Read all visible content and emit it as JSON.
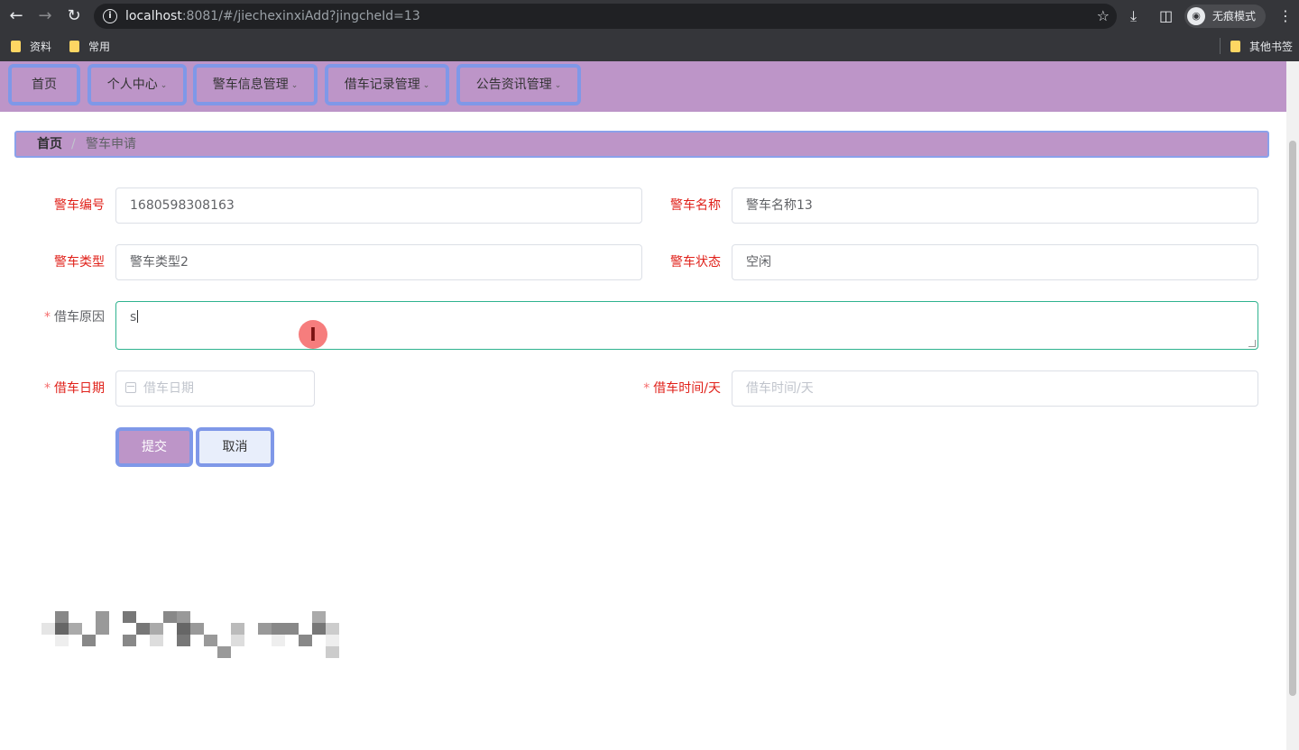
{
  "browser": {
    "url_host": "localhost",
    "url_rest": ":8081/#/jiechexinxiAdd?jingcheId=13",
    "profile_label": "无痕模式",
    "bookmarks": [
      "资料",
      "常用"
    ],
    "other_bookmarks": "其他书签"
  },
  "nav": {
    "items": [
      {
        "label": "首页",
        "has_dropdown": false
      },
      {
        "label": "个人中心",
        "has_dropdown": true
      },
      {
        "label": "警车信息管理",
        "has_dropdown": true
      },
      {
        "label": "借车记录管理",
        "has_dropdown": true
      },
      {
        "label": "公告资讯管理",
        "has_dropdown": true
      }
    ]
  },
  "breadcrumb": {
    "home": "首页",
    "separator": "/",
    "current": "警车申请"
  },
  "form": {
    "car_number": {
      "label": "警车编号",
      "value": "1680598308163"
    },
    "car_name": {
      "label": "警车名称",
      "value": "警车名称13"
    },
    "car_type": {
      "label": "警车类型",
      "value": "警车类型2"
    },
    "car_status": {
      "label": "警车状态",
      "value": "空闲"
    },
    "reason": {
      "label": "借车原因",
      "value": "s",
      "required": true
    },
    "borrow_date": {
      "label": "借车日期",
      "placeholder": "借车日期",
      "required": true
    },
    "borrow_days": {
      "label": "借车时间/天",
      "placeholder": "借车时间/天",
      "required": true
    },
    "required_mark": "*",
    "submit_label": "提交",
    "cancel_label": "取消"
  },
  "colors": {
    "theme_purple": "#bd95c8",
    "highlight_blue": "#7f98e8",
    "label_red": "#e0211a",
    "focus_green": "#2fb38f"
  }
}
